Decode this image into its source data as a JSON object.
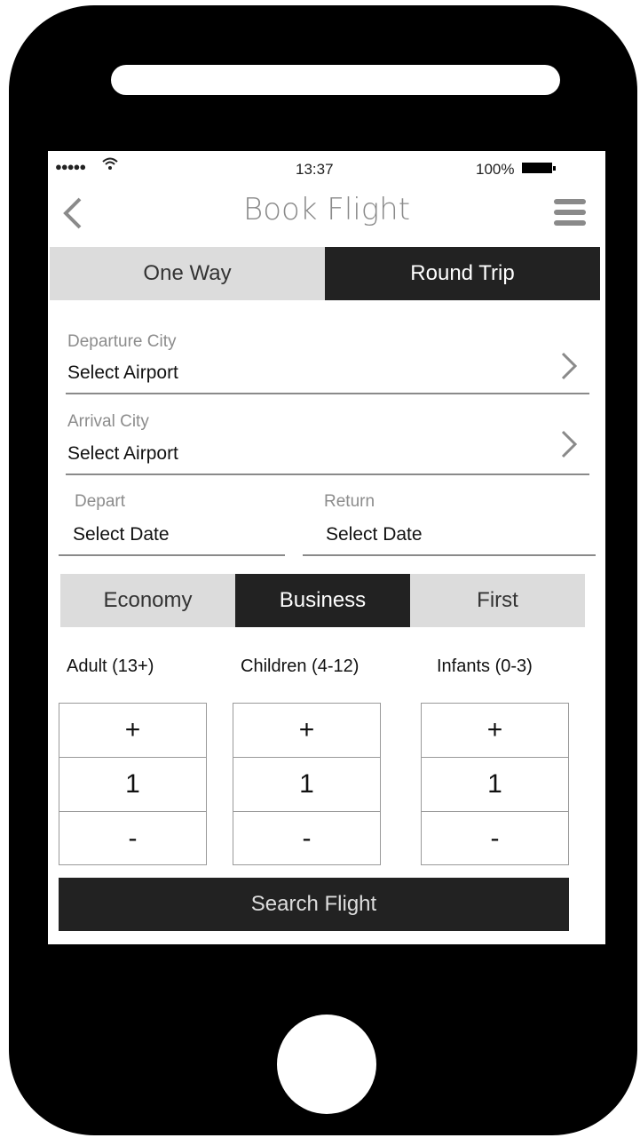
{
  "status": {
    "signal": "●●●●●",
    "time": "13:37",
    "battery": "100%"
  },
  "nav": {
    "title": "Book Flight"
  },
  "trip_type": {
    "one_way": "One Way",
    "round_trip": "Round Trip",
    "selected": "Round Trip"
  },
  "departure": {
    "label": "Departure City",
    "value": "Select Airport"
  },
  "arrival": {
    "label": "Arrival City",
    "value": "Select Airport"
  },
  "depart_date": {
    "label": "Depart",
    "value": "Select  Date"
  },
  "return_date": {
    "label": "Return",
    "value": "Select  Date"
  },
  "cabin": {
    "economy": "Economy",
    "business": "Business",
    "first": "First",
    "selected": "Business"
  },
  "passengers": {
    "adult": {
      "label": "Adult (13+)",
      "plus": "+",
      "count": "1",
      "minus": "-"
    },
    "children": {
      "label": "Children (4-12)",
      "plus": "+",
      "count": "1",
      "minus": "-"
    },
    "infants": {
      "label": "Infants (0-3)",
      "plus": "+",
      "count": "1",
      "minus": "-"
    }
  },
  "search_button": "Search Flight",
  "colors": {
    "accent_dark": "#222222",
    "segment_light": "#dcdcdc",
    "muted_text": "#8a8a8a"
  }
}
